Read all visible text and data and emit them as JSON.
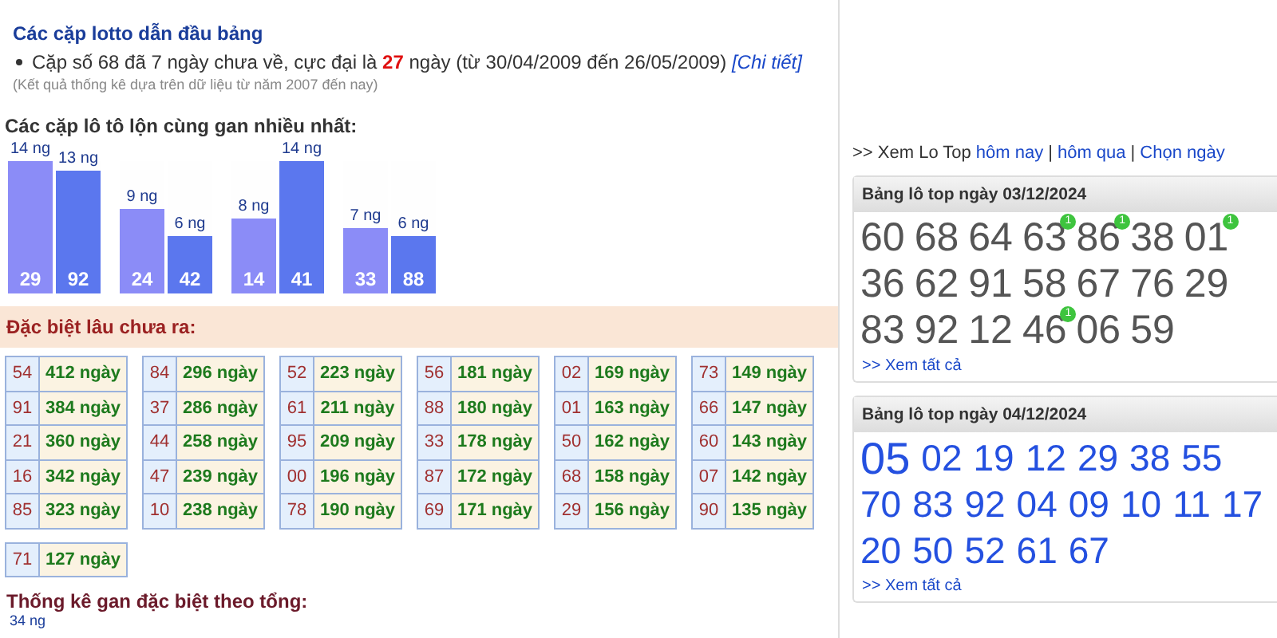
{
  "top_section": {
    "heading": "Các cặp lotto dẫn đầu bảng",
    "bullet": "Cặp số 68 đã 7 ngày chưa về, cực đại là **27** ngày (từ 30/04/2009 đến 26/05/2009)",
    "detail_link": "[Chi tiết]",
    "note": "(Kết quả thống kê dựa trên dữ liệu từ năm 2007 đến nay)"
  },
  "pair_chart": {
    "title": "Các cặp lô tô lộn cùng gan nhiều nhất:",
    "bars": [
      {
        "number": "29",
        "label": "14 ng",
        "level": 1.0,
        "color": "#8b8cf7"
      },
      {
        "number": "92",
        "label": "13 ng",
        "level": 0.93,
        "color": "#5b77ee"
      },
      {
        "number": "24",
        "label": "9 ng",
        "level": 0.64,
        "color": "#8b8cf7"
      },
      {
        "number": "42",
        "label": "6 ng",
        "level": 0.43,
        "color": "#5b77ee"
      },
      {
        "number": "14",
        "label": "8 ng",
        "level": 0.57,
        "color": "#8b8cf7"
      },
      {
        "number": "41",
        "label": "14 ng",
        "level": 1.0,
        "color": "#5b77ee"
      },
      {
        "number": "33",
        "label": "7 ng",
        "level": 0.5,
        "color": "#8b8cf7"
      },
      {
        "number": "88",
        "label": "6 ng",
        "level": 0.43,
        "color": "#5b77ee"
      }
    ]
  },
  "special": {
    "heading": "Đặc biệt lâu chưa ra:",
    "groups": [
      [
        {
          "number": "54",
          "days": "412 ngày"
        },
        {
          "number": "91",
          "days": "384 ngày"
        },
        {
          "number": "21",
          "days": "360 ngày"
        },
        {
          "number": "16",
          "days": "342 ngày"
        },
        {
          "number": "85",
          "days": "323 ngày"
        }
      ],
      [
        {
          "number": "84",
          "days": "296 ngày"
        },
        {
          "number": "37",
          "days": "286 ngày"
        },
        {
          "number": "44",
          "days": "258 ngày"
        },
        {
          "number": "47",
          "days": "239 ngày"
        },
        {
          "number": "10",
          "days": "238 ngày"
        }
      ],
      [
        {
          "number": "52",
          "days": "223 ngày"
        },
        {
          "number": "61",
          "days": "211 ngày"
        },
        {
          "number": "95",
          "days": "209 ngày"
        },
        {
          "number": "00",
          "days": "196 ngày"
        },
        {
          "number": "78",
          "days": "190 ngày"
        }
      ],
      [
        {
          "number": "56",
          "days": "181 ngày"
        },
        {
          "number": "88",
          "days": "180 ngày"
        },
        {
          "number": "33",
          "days": "178 ngày"
        },
        {
          "number": "87",
          "days": "172 ngày"
        },
        {
          "number": "69",
          "days": "171 ngày"
        }
      ],
      [
        {
          "number": "02",
          "days": "169 ngày"
        },
        {
          "number": "01",
          "days": "163 ngày"
        },
        {
          "number": "50",
          "days": "162 ngày"
        },
        {
          "number": "68",
          "days": "158 ngày"
        },
        {
          "number": "29",
          "days": "156 ngày"
        }
      ],
      [
        {
          "number": "73",
          "days": "149 ngày"
        },
        {
          "number": "66",
          "days": "147 ngày"
        },
        {
          "number": "60",
          "days": "143 ngày"
        },
        {
          "number": "07",
          "days": "142 ngày"
        },
        {
          "number": "90",
          "days": "135 ngày"
        }
      ],
      [
        {
          "number": "71",
          "days": "127 ngày"
        }
      ]
    ]
  },
  "sum_section": {
    "heading": "Thống kê gan đặc biệt theo tổng:",
    "first_value": "34 ng"
  },
  "lo_top_nav": [
    {
      "kind": "text",
      "text": ">> Xem Lo Top"
    },
    {
      "kind": "link",
      "text": "hôm nay"
    },
    {
      "kind": "sep",
      "text": "|"
    },
    {
      "kind": "link",
      "text": "hôm qua"
    },
    {
      "kind": "sep",
      "text": "|"
    },
    {
      "kind": "link",
      "text": "Chọn ngày"
    }
  ],
  "lo_top_boxes": [
    {
      "kind": "past",
      "title": "Bảng lô top ngày 03/12/2024",
      "numbers": [
        {
          "value": "60"
        },
        {
          "value": "68"
        },
        {
          "value": "64"
        },
        {
          "value": "63",
          "badge": "1"
        },
        {
          "value": "86",
          "badge": "1"
        },
        {
          "value": "38"
        },
        {
          "value": "01",
          "badge": "1"
        },
        {
          "value": "36"
        },
        {
          "value": "62"
        },
        {
          "value": "91"
        },
        {
          "value": "58"
        },
        {
          "value": "67"
        },
        {
          "value": "76"
        },
        {
          "value": "29"
        },
        {
          "value": "83"
        },
        {
          "value": "92"
        },
        {
          "value": "12"
        },
        {
          "value": "46",
          "badge": "1"
        },
        {
          "value": "06"
        },
        {
          "value": "59"
        }
      ],
      "more_link": ">> Xem tất cả"
    },
    {
      "kind": "current",
      "title": "Bảng lô top ngày 04/12/2024",
      "numbers": [
        {
          "value": "05"
        },
        {
          "value": "02"
        },
        {
          "value": "19"
        },
        {
          "value": "12"
        },
        {
          "value": "29"
        },
        {
          "value": "38"
        },
        {
          "value": "55"
        },
        {
          "value": "70"
        },
        {
          "value": "83"
        },
        {
          "value": "92"
        },
        {
          "value": "04"
        },
        {
          "value": "09"
        },
        {
          "value": "10"
        },
        {
          "value": "11"
        },
        {
          "value": "17"
        },
        {
          "value": "20"
        },
        {
          "value": "50"
        },
        {
          "value": "52"
        },
        {
          "value": "61"
        },
        {
          "value": "67"
        }
      ],
      "more_link": ">> Xem tất cả"
    }
  ]
}
